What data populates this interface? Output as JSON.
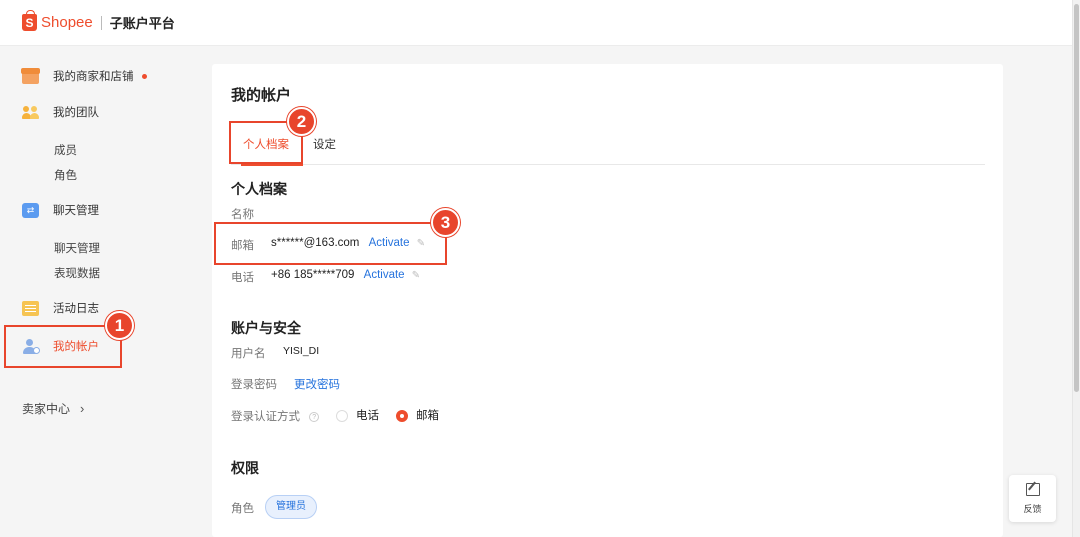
{
  "header": {
    "logo_glyph": "S",
    "logo_text": "Shopee",
    "platform_title": "子账户平台"
  },
  "sidebar": {
    "items": [
      {
        "label": "我的商家和店铺",
        "icon": "shop-icon"
      },
      {
        "label": "我的团队",
        "icon": "team-icon"
      },
      {
        "label": "成员"
      },
      {
        "label": "角色"
      },
      {
        "label": "聊天管理",
        "icon": "chat-icon"
      },
      {
        "label": "聊天管理"
      },
      {
        "label": "表现数据"
      },
      {
        "label": "活动日志",
        "icon": "log-icon"
      },
      {
        "label": "我的帐户",
        "icon": "account-icon",
        "active": true
      }
    ],
    "seller_center": "卖家中心",
    "chevron": "›"
  },
  "page": {
    "title": "我的帐户",
    "tabs": [
      {
        "label": "个人档案",
        "active": true
      },
      {
        "label": "设定"
      }
    ],
    "profile": {
      "title": "个人档案",
      "name_label": "名称",
      "email_label": "邮箱",
      "email_value": "s******@163.com",
      "email_action": "Activate",
      "phone_label": "电话",
      "phone_value": "+86 185*****709",
      "phone_action": "Activate",
      "edit_glyph": "✎"
    },
    "security": {
      "title": "账户与安全",
      "username_label": "用户名",
      "username_value": "YISI_DI",
      "password_label": "登录密码",
      "password_action": "更改密码",
      "auth_label": "登录认证方式",
      "help_glyph": "?",
      "auth_options": [
        {
          "label": "电话",
          "checked": false
        },
        {
          "label": "邮箱",
          "checked": true
        }
      ]
    },
    "permissions": {
      "title": "权限",
      "role_label": "角色",
      "role_value": "管理员"
    }
  },
  "annotations": [
    "1",
    "2",
    "3"
  ],
  "feedback": {
    "label": "反馈"
  },
  "colors": {
    "brand": "#ee4d2d",
    "link": "#2673dd",
    "annotation": "#e8452c"
  }
}
